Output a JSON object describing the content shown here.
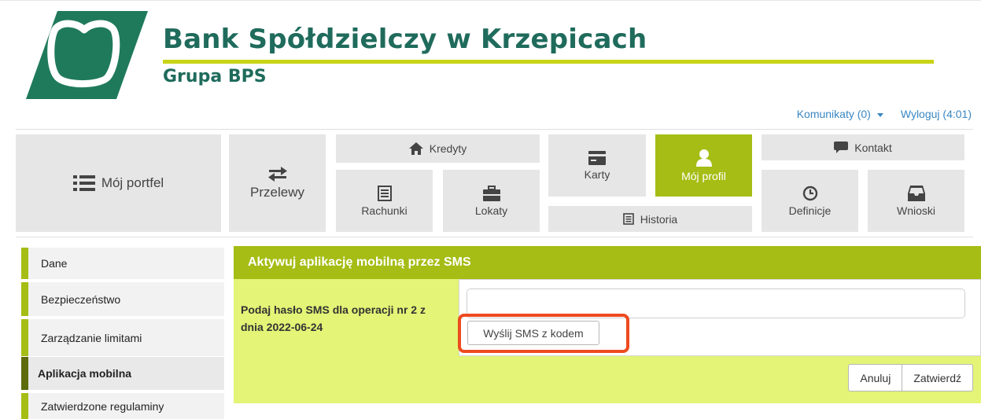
{
  "header": {
    "bank_name": "Bank Spółdzielczy w Krzepicach",
    "group_name": "Grupa BPS",
    "logo_icon": "bps-logo-icon"
  },
  "top_links": {
    "messages": "Komunikaty (0)",
    "logout": "Wyloguj (4:01)"
  },
  "nav": {
    "portfolio": "Mój portfel",
    "transfers": "Przelewy",
    "credits": "Kredyty",
    "accounts": "Rachunki",
    "deposits": "Lokaty",
    "cards": "Karty",
    "profile": "Mój profil",
    "history": "Historia",
    "contact": "Kontakt",
    "definitions": "Definicje",
    "requests": "Wnioski"
  },
  "sidebar": {
    "items": [
      {
        "label": "Dane"
      },
      {
        "label": "Bezpieczeństwo"
      },
      {
        "label": "Zarządzanie limitami"
      },
      {
        "label": "Aplikacja mobilna"
      },
      {
        "label": "Zatwierdzone regulaminy"
      }
    ]
  },
  "panel": {
    "title": "Aktywuj aplikację mobilną przez SMS",
    "label": "Podaj hasło SMS dla operacji nr 2 z dnia 2022-06-24",
    "input_value": "",
    "send_button": "Wyślij SMS z kodem",
    "cancel_button": "Anuluj",
    "confirm_button": "Zatwierdź"
  },
  "colors": {
    "accent": "#a5bd14",
    "panel_bg": "#e3f476",
    "brand_green": "#1f6b5c",
    "highlight": "#ee4a1f",
    "link": "#3a87c2"
  }
}
